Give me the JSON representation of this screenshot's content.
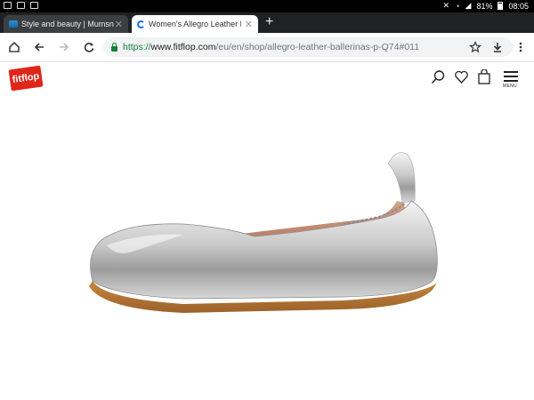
{
  "status_bar": {
    "battery": "81%",
    "time": "08:05"
  },
  "tabs": [
    {
      "title": "Style and beauty | Mumsnet S",
      "active": false
    },
    {
      "title": "Women's Allegro Leather Blac",
      "active": true
    }
  ],
  "new_tab_label": "+",
  "address": {
    "scheme": "https://",
    "host": "www.fitflop.com",
    "path": "/eu/en/shop/allegro-leather-ballerinas-p-Q74#011"
  },
  "site": {
    "logo_text": "fitflop",
    "menu_label": "MENU"
  },
  "colors": {
    "brand": "#e1251b",
    "secure": "#188038",
    "tabstrip": "#202124"
  },
  "icons": [
    "back-icon",
    "forward-icon",
    "reload-icon",
    "home-icon",
    "star-icon",
    "download-icon",
    "more-icon",
    "search-icon",
    "heart-icon",
    "bag-icon",
    "menu-icon"
  ]
}
